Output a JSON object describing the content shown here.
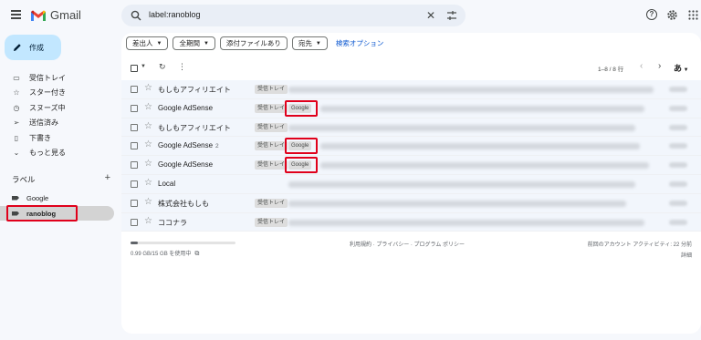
{
  "app": {
    "name": "Gmail"
  },
  "search": {
    "value": "label:ranoblog"
  },
  "compose": {
    "label": "作成"
  },
  "nav": [
    {
      "icon": "inbox-icon",
      "label": "受信トレイ"
    },
    {
      "icon": "star-icon",
      "label": "スター付き"
    },
    {
      "icon": "clock-icon",
      "label": "スヌーズ中"
    },
    {
      "icon": "send-icon",
      "label": "送信済み"
    },
    {
      "icon": "draft-icon",
      "label": "下書き"
    },
    {
      "icon": "chevron-down-icon",
      "label": "もっと見る"
    }
  ],
  "labels": {
    "heading": "ラベル",
    "items": [
      {
        "label": "Google",
        "active": false
      },
      {
        "label": "ranoblog",
        "active": true
      }
    ]
  },
  "filters": {
    "chips": [
      "差出人",
      "全期間",
      "添付ファイルあり",
      "宛先"
    ],
    "advanced": "検索オプション"
  },
  "toolbar": {
    "pager": "1–8 / 8 行",
    "sort": "あ"
  },
  "emails": [
    {
      "sender": "もしもアフィリエイト",
      "count": "",
      "inbox": "受信トレイ",
      "google": "",
      "highlight": false
    },
    {
      "sender": "Google AdSense",
      "count": "",
      "inbox": "受信トレイ",
      "google": "Google",
      "highlight": true
    },
    {
      "sender": "もしもアフィリエイト",
      "count": "",
      "inbox": "受信トレイ",
      "google": "",
      "highlight": false
    },
    {
      "sender": "Google AdSense",
      "count": "2",
      "inbox": "受信トレイ",
      "google": "Google",
      "highlight": true
    },
    {
      "sender": "Google AdSense",
      "count": "",
      "inbox": "受信トレイ",
      "google": "Google",
      "highlight": true
    },
    {
      "sender": "Local",
      "count": "",
      "inbox": "",
      "google": "",
      "highlight": false
    },
    {
      "sender": "株式会社もしも",
      "count": "",
      "inbox": "受信トレイ",
      "google": "",
      "highlight": false
    },
    {
      "sender": "ココナラ",
      "count": "",
      "inbox": "受信トレイ",
      "google": "",
      "highlight": false
    }
  ],
  "footer": {
    "storage": "0.99 GB/15 GB を使用中",
    "storage_fraction": 0.066,
    "terms": "利用規約 · プライバシー · プログラム ポリシー",
    "activity": "前回のアカウント アクティビティ: 22 分前",
    "details": "詳細"
  }
}
